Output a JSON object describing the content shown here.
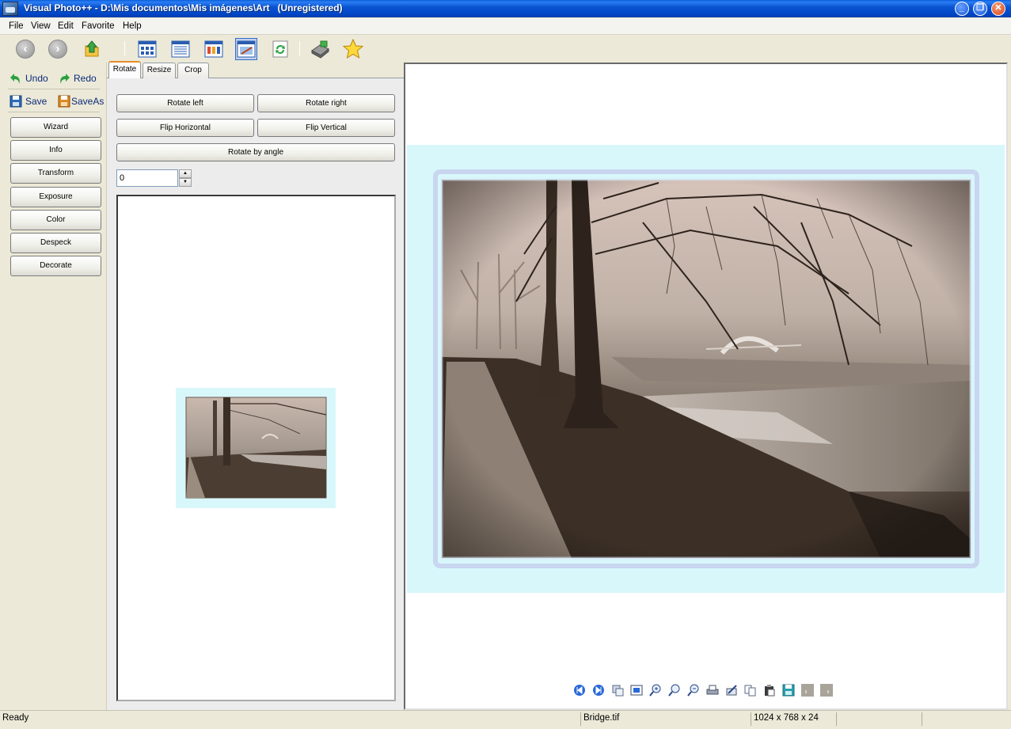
{
  "window": {
    "title": "Visual Photo++ - D:\\Mis documentos\\Mis imágenes\\Art   (Unregistered)",
    "minimize_label": "_",
    "restore_label": "❐",
    "close_label": "✕"
  },
  "menu": {
    "items": [
      {
        "label": "File"
      },
      {
        "label": "View"
      },
      {
        "label": "Edit"
      },
      {
        "label": "Favorite"
      },
      {
        "label": "Help"
      }
    ]
  },
  "toolbar": {
    "icons": [
      "back-icon",
      "forward-icon",
      "up-folder-icon",
      "thumbnails-view-icon",
      "details-view-icon",
      "filmstrip-view-icon",
      "image-edit-view-icon",
      "refresh-icon",
      "scanner-icon",
      "favorite-star-icon"
    ]
  },
  "left_panel": {
    "undo_label": "Undo",
    "redo_label": "Redo",
    "save_label": "Save",
    "saveas_label": "SaveAs",
    "commands": [
      "Wizard",
      "Info",
      "Transform",
      "Exposure",
      "Color",
      "Despeck",
      "Decorate"
    ]
  },
  "transform_panel": {
    "tabs": [
      {
        "label": "Rotate",
        "active": true
      },
      {
        "label": "Resize",
        "active": false
      },
      {
        "label": "Crop",
        "active": false
      }
    ],
    "rotate_left_label": "Rotate left",
    "rotate_right_label": "Rotate right",
    "flip_horizontal_label": "Flip Horizontal",
    "flip_vertical_label": "Flip Vertical",
    "rotate_by_angle_label": "Rotate by angle",
    "angle_value": "0"
  },
  "viewer": {
    "nav_icons": [
      "first-image-icon",
      "next-image-icon",
      "copy-to-icon",
      "fit-to-window-icon",
      "zoom-in-icon",
      "zoom-actual-icon",
      "zoom-out-icon",
      "print-icon",
      "edit-icon",
      "copy-icon",
      "paste-icon",
      "save-icon",
      "prev-page-icon",
      "next-page-icon"
    ]
  },
  "status": {
    "state": "Ready",
    "filename": "Bridge.tif",
    "dimensions": "1024 x 768 x 24"
  },
  "colors": {
    "titlebar": "#0a54d2",
    "frame_background": "#d8f7fb",
    "photo_sepia": "#8a7a6c"
  }
}
